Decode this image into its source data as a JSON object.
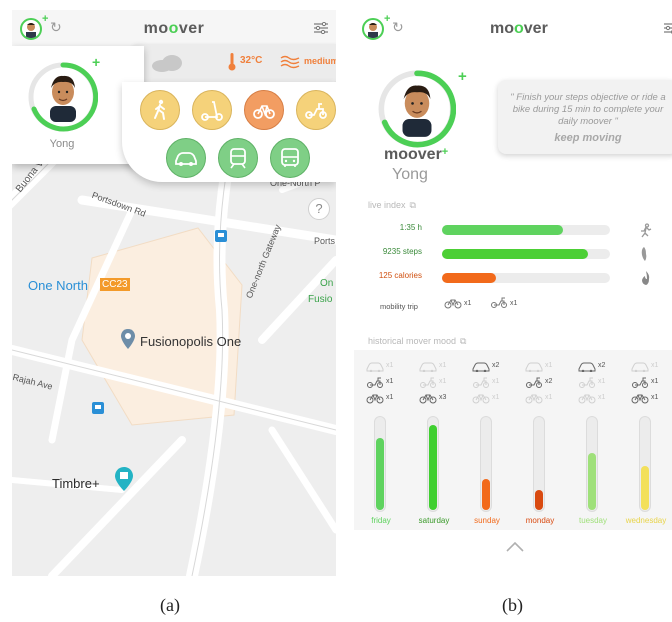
{
  "captions": {
    "a": "(a)",
    "b": "(b)"
  },
  "colors": {
    "accent_green": "#4ccf55",
    "orange": "#f0803c",
    "yellow": "#f5d27a",
    "bar_green": "#5fd35f",
    "bar_orange": "#f26a1b"
  },
  "app": {
    "logo_prefix": "mo",
    "logo_o": "o",
    "logo_suffix": "ver",
    "logo_b_prefix": "mo",
    "logo_b_o": "o",
    "logo_b_suffix": "ver"
  },
  "panel_a": {
    "user_name": "Yong",
    "weather": {
      "temperature": "32°C",
      "wind": "medium",
      "icons": [
        "cloud-icon",
        "thermometer-icon",
        "wind-icon"
      ]
    },
    "modes": [
      {
        "name": "walk",
        "color": "yellow"
      },
      {
        "name": "scooter",
        "color": "yellow"
      },
      {
        "name": "bike",
        "color": "orange"
      },
      {
        "name": "moped",
        "color": "yellow"
      },
      {
        "name": "car",
        "color": "green"
      },
      {
        "name": "train",
        "color": "green"
      },
      {
        "name": "bus",
        "color": "green"
      }
    ],
    "map_labels": {
      "road_1": "Buona Vista Rd",
      "road_2": "Portsdown Rd",
      "road_3": "One-North P",
      "road_4": "Ports",
      "road_5": "One-north Gateway",
      "station": "One North",
      "station_code": "CC23",
      "poi_1": "Fusionopolis One",
      "poi_2": "Timbre+",
      "road_6": "Rajah Ave",
      "side_1": "On",
      "side_2": "Fusio"
    },
    "help": "?"
  },
  "panel_b": {
    "profile_logo_prefix": "moover",
    "profile_plus": "+",
    "user_name": "Yong",
    "quote": "\" Finish your steps objective or ride a bike during 15 min to complete your daily moover \"",
    "quote_sub": "keep moving",
    "live_index_title": "live index",
    "live_metrics": [
      {
        "value": "1:35 h",
        "fraction": 0.72,
        "color": "#5fd35f",
        "label_color": "#3a8a3a",
        "icon": "running-icon"
      },
      {
        "value": "9235 steps",
        "fraction": 0.87,
        "color": "#4ccf35",
        "label_color": "#3a8a3a",
        "icon": "footprint-icon"
      },
      {
        "value": "125 calories",
        "fraction": 0.32,
        "color": "#f26a1b",
        "label_color": "#d05010",
        "icon": "flame-icon"
      }
    ],
    "mobility_trip": {
      "label": "mobility trip",
      "items": [
        {
          "icon": "bike-icon",
          "count": "x1"
        },
        {
          "icon": "scooter-icon",
          "count": "x1"
        }
      ]
    },
    "historical_title": "historical mover mood",
    "days": [
      {
        "name": "friday",
        "fill": 0.78,
        "color": "#5fd35f",
        "label_color": "#5fd35f",
        "modes": [
          {
            "icon": "car-icon",
            "count": "x1",
            "faded": true
          },
          {
            "icon": "moped-icon",
            "count": "x1",
            "faded": false
          },
          {
            "icon": "bike-icon",
            "count": "x1",
            "faded": false
          }
        ]
      },
      {
        "name": "saturday",
        "fill": 0.92,
        "color": "#3fcf30",
        "label_color": "#3a9a2a",
        "modes": [
          {
            "icon": "car-icon",
            "count": "x1",
            "faded": true
          },
          {
            "icon": "moped-icon",
            "count": "x1",
            "faded": true
          },
          {
            "icon": "bike-icon",
            "count": "x3",
            "faded": false
          }
        ]
      },
      {
        "name": "sunday",
        "fill": 0.34,
        "color": "#f26a1b",
        "label_color": "#f26a1b",
        "modes": [
          {
            "icon": "car-icon",
            "count": "x2",
            "faded": false
          },
          {
            "icon": "moped-icon",
            "count": "x1",
            "faded": true
          },
          {
            "icon": "bike-icon",
            "count": "x1",
            "faded": true
          }
        ]
      },
      {
        "name": "monday",
        "fill": 0.22,
        "color": "#d94a10",
        "label_color": "#d94a10",
        "modes": [
          {
            "icon": "car-icon",
            "count": "x1",
            "faded": true
          },
          {
            "icon": "moped-icon",
            "count": "x2",
            "faded": false
          },
          {
            "icon": "bike-icon",
            "count": "x1",
            "faded": true
          }
        ]
      },
      {
        "name": "tuesday",
        "fill": 0.62,
        "color": "#9fe07a",
        "label_color": "#9fe07a",
        "modes": [
          {
            "icon": "car-icon",
            "count": "x2",
            "faded": false
          },
          {
            "icon": "moped-icon",
            "count": "x1",
            "faded": true
          },
          {
            "icon": "bike-icon",
            "count": "x1",
            "faded": true
          }
        ]
      },
      {
        "name": "wednesday",
        "fill": 0.48,
        "color": "#f3e05a",
        "label_color": "#e8d44a",
        "modes": [
          {
            "icon": "car-icon",
            "count": "x1",
            "faded": true
          },
          {
            "icon": "moped-icon",
            "count": "x1",
            "faded": false
          },
          {
            "icon": "bike-icon",
            "count": "x1",
            "faded": false
          }
        ]
      }
    ]
  }
}
